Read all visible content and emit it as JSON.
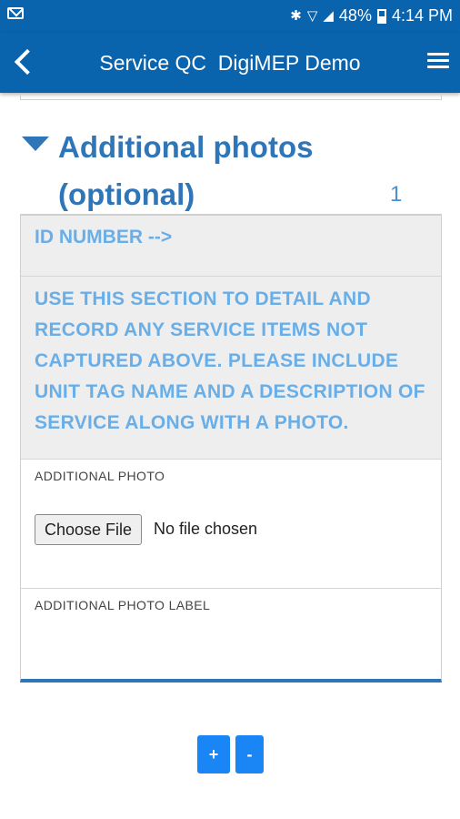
{
  "status_bar": {
    "battery_percent": "48%",
    "time": "4:14 PM",
    "icons": [
      "mail-icon",
      "bluetooth-icon",
      "wifi-icon",
      "signal-icon",
      "battery-icon"
    ]
  },
  "app_bar": {
    "title": "Service QC  DigiMEP Demo",
    "back_icon": "chevron-left-icon",
    "menu_icon": "hamburger-menu-icon"
  },
  "section": {
    "title": "Additional photos (optional)",
    "count": "1",
    "icon": "collapse-triangle-icon"
  },
  "form": {
    "id_label": "ID NUMBER -->",
    "instructions": "USE THIS SECTION TO DETAIL AND RECORD ANY SERVICE ITEMS NOT CAPTURED ABOVE. PLEASE INCLUDE UNIT TAG NAME AND A DESCRIPTION OF SERVICE ALONG WITH A PHOTO.",
    "photo_label": "ADDITIONAL PHOTO",
    "choose_file_label": "Choose File",
    "file_status": "No file chosen",
    "photo_label_field_label": "ADDITIONAL PHOTO LABEL",
    "photo_label_value": ""
  },
  "repeat_controls": {
    "add_label": "+",
    "remove_label": "-"
  },
  "colors": {
    "app_bar": "#0a63ad",
    "heading": "#2f76b8",
    "info_text": "#6aaee8",
    "action_button": "#1a86f5"
  }
}
